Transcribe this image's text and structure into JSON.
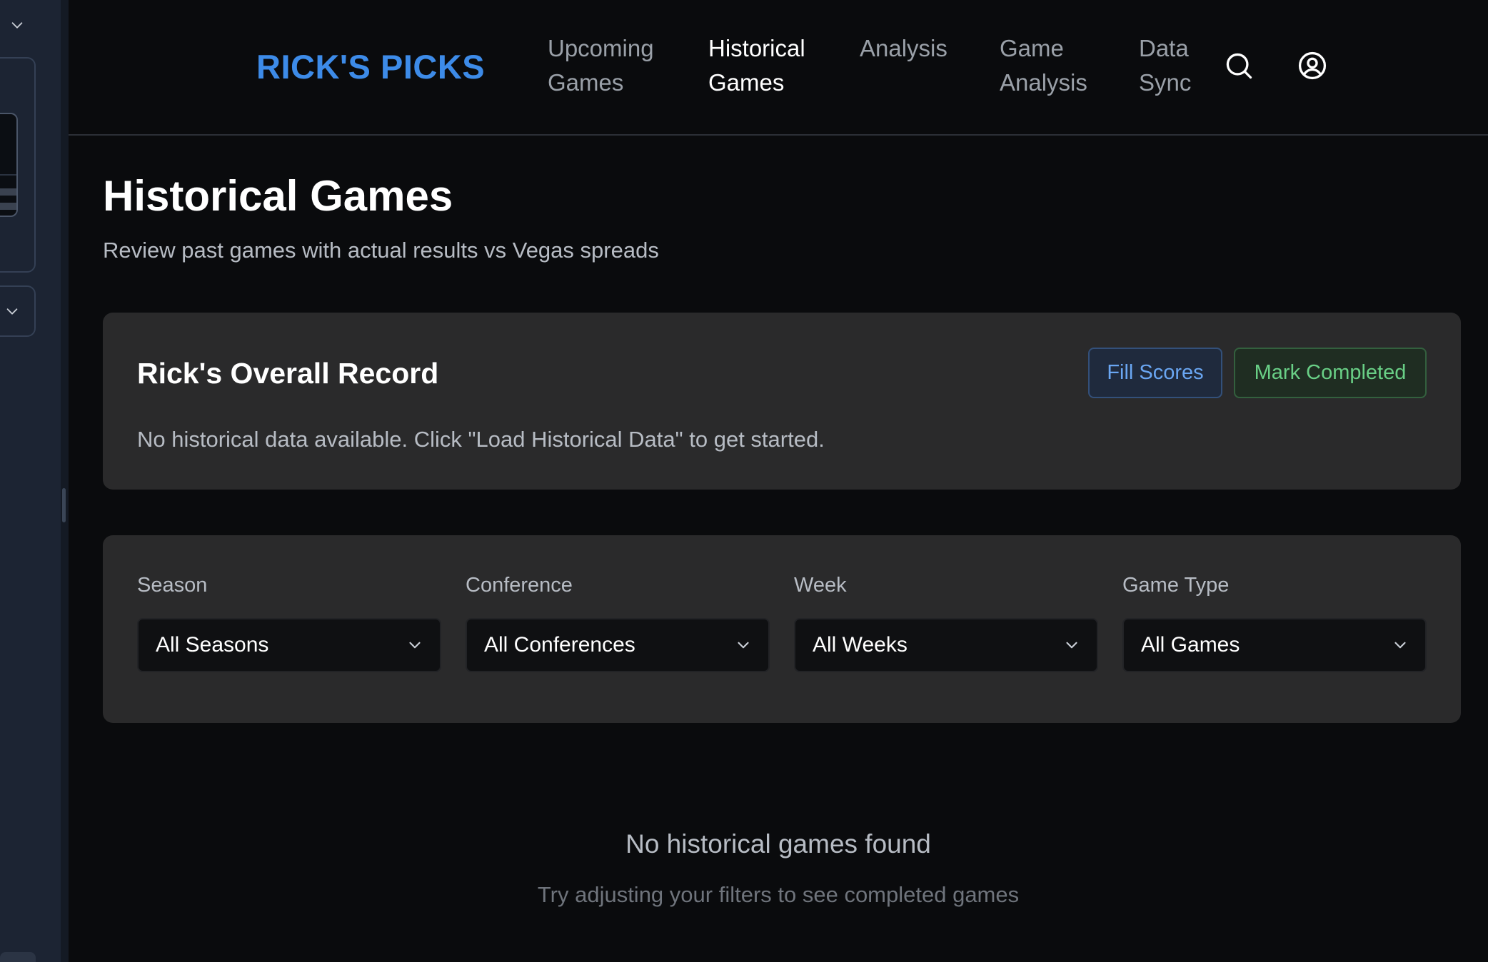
{
  "header": {
    "brand": "RICK'S PICKS",
    "nav": [
      {
        "line1": "Upcoming",
        "line2": "Games"
      },
      {
        "line1": "Historical",
        "line2": "Games"
      },
      {
        "line1": "Analysis",
        "line2": ""
      },
      {
        "line1": "Game",
        "line2": "Analysis"
      },
      {
        "line1": "Data",
        "line2": "Sync"
      }
    ],
    "active_nav": "Historical Games",
    "icons": [
      "search-icon",
      "user-account-icon"
    ]
  },
  "page": {
    "title": "Historical Games",
    "subtitle": "Review past games with actual results vs Vegas spreads"
  },
  "record": {
    "title": "Rick's Overall Record",
    "message": "No historical data available. Click \"Load Historical Data\" to get started.",
    "fill_scores_label": "Fill Scores",
    "mark_completed_label": "Mark Completed"
  },
  "filters": {
    "season": {
      "label": "Season",
      "value": "All Seasons"
    },
    "conference": {
      "label": "Conference",
      "value": "All Conferences"
    },
    "week": {
      "label": "Week",
      "value": "All Weeks"
    },
    "game_type": {
      "label": "Game Type",
      "value": "All Games"
    }
  },
  "empty": {
    "title": "No historical games found",
    "subtitle": "Try adjusting your filters to see completed games"
  },
  "colors": {
    "brand": "#3d8be8",
    "background": "#0a0b0d",
    "card": "#2a2a2b",
    "fill_scores": "#6aa6f2",
    "mark_completed": "#69cf86"
  }
}
